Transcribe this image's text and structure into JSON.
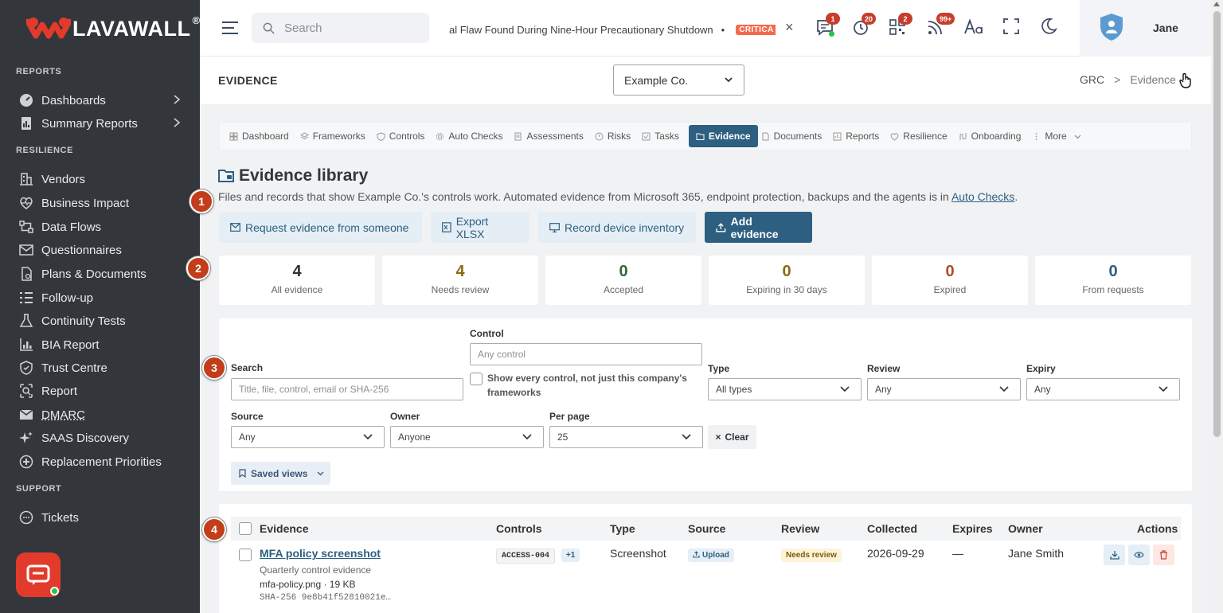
{
  "app": {
    "brand": "LAVAWALL",
    "trademark": "®",
    "accent": "#2d5f81",
    "brand_red": "#e33b2b"
  },
  "sidebar": {
    "sections": [
      {
        "title": "REPORTS",
        "items": [
          {
            "label": "Dashboards",
            "icon": "speedometer-icon",
            "chevron": true
          },
          {
            "label": "Summary Reports",
            "icon": "report-icon",
            "chevron": true
          }
        ]
      },
      {
        "title": "RESILIENCE",
        "items": [
          {
            "label": "Vendors",
            "icon": "building-icon"
          },
          {
            "label": "Business Impact",
            "icon": "heart-pulse-icon"
          },
          {
            "label": "Data Flows",
            "icon": "flow-icon"
          },
          {
            "label": "Questionnaires",
            "icon": "envelope-check-icon"
          },
          {
            "label": "Plans & Documents",
            "icon": "document-icon"
          },
          {
            "label": "Follow-up",
            "icon": "list-icon"
          },
          {
            "label": "Continuity Tests",
            "icon": "flask-icon"
          },
          {
            "label": "BIA Report",
            "icon": "bar-chart-icon"
          },
          {
            "label": "Trust Centre",
            "icon": "shield-icon"
          },
          {
            "label": "Report",
            "icon": "search-doc-icon"
          },
          {
            "label": "DMARC",
            "icon": "mail-shield-icon"
          },
          {
            "label": "SAAS Discovery",
            "icon": "sparkle-icon"
          },
          {
            "label": "Replacement Priorities",
            "icon": "priority-icon"
          }
        ]
      },
      {
        "title": "SUPPORT",
        "items": [
          {
            "label": "Tickets",
            "icon": "ticket-icon"
          }
        ]
      }
    ]
  },
  "topbar": {
    "search_placeholder": "Search",
    "ticker_text": "al Flaw Found During Nine-Hour Precautionary Shutdown",
    "ticker_bullet": "•",
    "ticker_tag": "CRITICA",
    "ticker_close": "×",
    "badges": {
      "messages": "1",
      "alerts": "20",
      "qr": "2",
      "feeds": "99+"
    },
    "user_name": "Jane"
  },
  "header": {
    "title": "EVIDENCE",
    "company": "Example Co.",
    "breadcrumb": [
      "GRC",
      "Evidence"
    ],
    "breadcrumb_sep": ">"
  },
  "tabs": [
    {
      "label": "Dashboard"
    },
    {
      "label": "Frameworks"
    },
    {
      "label": "Controls"
    },
    {
      "label": "Auto Checks"
    },
    {
      "label": "Assessments"
    },
    {
      "label": "Risks"
    },
    {
      "label": "Tasks"
    },
    {
      "label": "Evidence",
      "active": true
    },
    {
      "label": "Documents"
    },
    {
      "label": "Reports"
    },
    {
      "label": "Resilience"
    },
    {
      "label": "Onboarding"
    },
    {
      "label": "More"
    }
  ],
  "page": {
    "title": "Evidence library",
    "lead_text": "Files and records that show Example Co.'s controls work. Automated evidence from Microsoft 365, endpoint protection, backups and the agents is in ",
    "lead_link": "Auto Checks",
    "lead_end": ".",
    "actions": {
      "request": "Request evidence from someone",
      "export": "Export XLSX",
      "inventory": "Record device inventory",
      "add": "Add evidence"
    }
  },
  "stats": [
    {
      "value": "4",
      "label": "All evidence",
      "color": "#2d3036"
    },
    {
      "value": "4",
      "label": "Needs review",
      "color": "#8a6a12"
    },
    {
      "value": "0",
      "label": "Accepted",
      "color": "#2f6b3a"
    },
    {
      "value": "0",
      "label": "Expiring in 30 days",
      "color": "#8a6a12"
    },
    {
      "value": "0",
      "label": "Expired",
      "color": "#b04a2c"
    },
    {
      "value": "0",
      "label": "From requests",
      "color": "#2d5f81"
    }
  ],
  "filters": {
    "control_label": "Control",
    "control_placeholder": "Any control",
    "show_all_label": "Show every control, not just this company's frameworks",
    "search_label": "Search",
    "search_placeholder": "Title, file, control, email or SHA-256",
    "type_label": "Type",
    "type_value": "All types",
    "review_label": "Review",
    "review_value": "Any",
    "expiry_label": "Expiry",
    "expiry_value": "Any",
    "source_label": "Source",
    "source_value": "Any",
    "owner_label": "Owner",
    "owner_value": "Anyone",
    "perpage_label": "Per page",
    "perpage_value": "25",
    "clear": "Clear",
    "saved_views": "Saved views"
  },
  "table": {
    "headers": [
      "Evidence",
      "Controls",
      "Type",
      "Source",
      "Review",
      "Collected",
      "Expires",
      "Owner",
      "Actions"
    ],
    "rows": [
      {
        "title": "MFA policy screenshot",
        "subtitle": "Quarterly control evidence",
        "file": "mfa-policy.png · 19 KB",
        "sha": "SHA-256 9e8b41f52810021e…",
        "control": "ACCESS-004",
        "control_more": "+1",
        "type": "Screenshot",
        "source": "Upload",
        "review": "Needs review",
        "collected": "2026-09-29",
        "expires": "—",
        "owner": "Jane Smith"
      }
    ]
  },
  "callouts": [
    "1",
    "2",
    "3",
    "4"
  ]
}
